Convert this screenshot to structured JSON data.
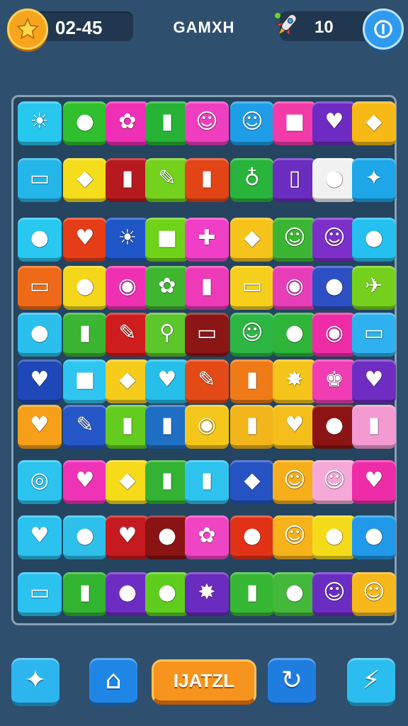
{
  "hud": {
    "timer": "02-45",
    "title": "GAMXH",
    "score": "10"
  },
  "bottom_bar": {
    "main_label": "IJATZL"
  },
  "board": {
    "rows": [
      [
        {
          "color": "#28c7ee",
          "glyph": "☀",
          "icon": "sun-icon"
        },
        {
          "color": "#2fbf2f",
          "glyph": "●",
          "icon": "fruit-icon"
        },
        {
          "color": "#ef2fb6",
          "glyph": "✿",
          "icon": "flame-icon"
        },
        {
          "color": "#27b336",
          "glyph": "▮",
          "icon": "phone-icon"
        },
        {
          "color": "#ef3ec0",
          "glyph": "☺",
          "icon": "face-icon"
        },
        {
          "color": "#1f9ee8",
          "glyph": "☺",
          "icon": "monster-icon"
        },
        {
          "color": "#f23aa8",
          "glyph": "■",
          "icon": "box-icon"
        },
        {
          "color": "#6d2bc4",
          "glyph": "♥",
          "icon": "heart-icon"
        },
        {
          "color": "#f6b916",
          "glyph": "◆",
          "icon": "candy-icon"
        }
      ],
      [
        {
          "color": "#24b6e8",
          "glyph": "▭",
          "icon": "eyes-icon"
        },
        {
          "color": "#f4dd1a",
          "glyph": "◆",
          "icon": "gem-icon"
        },
        {
          "color": "#b61a1f",
          "glyph": "▮",
          "icon": "battery-icon"
        },
        {
          "color": "#74d11c",
          "glyph": "✎",
          "icon": "pen-icon"
        },
        {
          "color": "#e24416",
          "glyph": "▮",
          "icon": "phone-icon"
        },
        {
          "color": "#29b43c",
          "glyph": "♁",
          "icon": "pin-icon"
        },
        {
          "color": "#6b2cc0",
          "glyph": "▯",
          "icon": "jar-icon"
        },
        {
          "color": "#f1f1f1",
          "glyph": "●",
          "icon": "orb-icon"
        },
        {
          "color": "#1da6e8",
          "glyph": "✦",
          "icon": "sparkle-icon"
        }
      ],
      [
        {
          "color": "#29c8f0",
          "glyph": "●",
          "icon": "bubble-icon"
        },
        {
          "color": "#e53d18",
          "glyph": "♥",
          "icon": "heart-icon"
        },
        {
          "color": "#1f55c6",
          "glyph": "☀",
          "icon": "sun-face-icon"
        },
        {
          "color": "#6fd31a",
          "glyph": "■",
          "icon": "bag-icon"
        },
        {
          "color": "#f03fc6",
          "glyph": "✚",
          "icon": "puzzle-icon"
        },
        {
          "color": "#f6c31b",
          "glyph": "◆",
          "icon": "balloon-icon"
        },
        {
          "color": "#3db534",
          "glyph": "☺",
          "icon": "apple-face-icon"
        },
        {
          "color": "#7c2fc9",
          "glyph": "☺",
          "icon": "alien-icon"
        },
        {
          "color": "#25bff0",
          "glyph": "●",
          "icon": "lollipop-icon"
        }
      ],
      [
        {
          "color": "#ef6a16",
          "glyph": "▭",
          "icon": "tv-icon"
        },
        {
          "color": "#f4d61a",
          "glyph": "●",
          "icon": "ball-icon"
        },
        {
          "color": "#ef30b2",
          "glyph": "◉",
          "icon": "speech-icon"
        },
        {
          "color": "#3fb530",
          "glyph": "✿",
          "icon": "bird-icon"
        },
        {
          "color": "#ec3ab8",
          "glyph": "▮",
          "icon": "bottle-icon"
        },
        {
          "color": "#f6cf1c",
          "glyph": "▭",
          "icon": "chest-icon"
        },
        {
          "color": "#e63db8",
          "glyph": "◉",
          "icon": "pin-icon"
        },
        {
          "color": "#2c4fc4",
          "glyph": "●",
          "icon": "plum-icon"
        },
        {
          "color": "#74d01c",
          "glyph": "✈",
          "icon": "rocket-icon"
        }
      ],
      [
        {
          "color": "#2bbfee",
          "glyph": "●",
          "icon": "grape-icon"
        },
        {
          "color": "#3bb532",
          "glyph": "▮",
          "icon": "eraser-icon"
        },
        {
          "color": "#cf1c1c",
          "glyph": "✎",
          "icon": "pencil-icon"
        },
        {
          "color": "#5dc62b",
          "glyph": "⚲",
          "icon": "racket-icon"
        },
        {
          "color": "#8c1515",
          "glyph": "▭",
          "icon": "card-icon"
        },
        {
          "color": "#2db644",
          "glyph": "☺",
          "icon": "ball-face-icon"
        },
        {
          "color": "#2fb43a",
          "glyph": "●",
          "icon": "balloon-icon"
        },
        {
          "color": "#ef2ca6",
          "glyph": "◉",
          "icon": "donut-icon"
        },
        {
          "color": "#2fb1ef",
          "glyph": "▭",
          "icon": "tablet-icon"
        }
      ],
      [
        {
          "color": "#1e47b8",
          "glyph": "♥",
          "icon": "heart-icon"
        },
        {
          "color": "#2ec6f0",
          "glyph": "■",
          "icon": "cube-icon"
        },
        {
          "color": "#f6cc1c",
          "glyph": "◆",
          "icon": "drop-icon"
        },
        {
          "color": "#25bfea",
          "glyph": "♥",
          "icon": "heart-icon"
        },
        {
          "color": "#e34a16",
          "glyph": "✎",
          "icon": "crayon-icon"
        },
        {
          "color": "#f07a17",
          "glyph": "▮",
          "icon": "battery-icon"
        },
        {
          "color": "#f5c41b",
          "glyph": "✸",
          "icon": "star-burst-icon"
        },
        {
          "color": "#f03db4",
          "glyph": "♚",
          "icon": "crown-icon"
        },
        {
          "color": "#6f2cc2",
          "glyph": "♥",
          "icon": "heart-icon"
        }
      ],
      [
        {
          "color": "#f6a01a",
          "glyph": "♥",
          "icon": "apple-icon"
        },
        {
          "color": "#2657c9",
          "glyph": "✎",
          "icon": "pencil-icon"
        },
        {
          "color": "#63cc1f",
          "glyph": "▮",
          "icon": "cup-icon"
        },
        {
          "color": "#1f6fc4",
          "glyph": "▮",
          "icon": "phone-icon"
        },
        {
          "color": "#f4c61a",
          "glyph": "◉",
          "icon": "ring-icon"
        },
        {
          "color": "#f2b61b",
          "glyph": "▮",
          "icon": "phone-icon"
        },
        {
          "color": "#f4be1b",
          "glyph": "♥",
          "icon": "heart-icon"
        },
        {
          "color": "#8d1414",
          "glyph": "●",
          "icon": "leaf-icon"
        },
        {
          "color": "#f39ad2",
          "glyph": "▮",
          "icon": "battery-icon"
        }
      ],
      [
        {
          "color": "#2cc4ef",
          "glyph": "◎",
          "icon": "target-icon"
        },
        {
          "color": "#ef33b6",
          "glyph": "♥",
          "icon": "heart-icon"
        },
        {
          "color": "#f6db1a",
          "glyph": "◆",
          "icon": "gem-icon"
        },
        {
          "color": "#34b233",
          "glyph": "▮",
          "icon": "battery-icon"
        },
        {
          "color": "#2ec2ee",
          "glyph": "▮",
          "icon": "phone-icon"
        },
        {
          "color": "#2653c4",
          "glyph": "◆",
          "icon": "gem-icon"
        },
        {
          "color": "#f6ae1a",
          "glyph": "☺",
          "icon": "smiley-icon"
        },
        {
          "color": "#f4a9d8",
          "glyph": "☺",
          "icon": "cat-face-icon"
        },
        {
          "color": "#ef2ca7",
          "glyph": "♥",
          "icon": "heart-icon"
        }
      ],
      [
        {
          "color": "#2bc2ef",
          "glyph": "♥",
          "icon": "heart-icon"
        },
        {
          "color": "#2ec0ea",
          "glyph": "●",
          "icon": "balloon-icon"
        },
        {
          "color": "#c51a1f",
          "glyph": "♥",
          "icon": "heart-icon"
        },
        {
          "color": "#8a1313",
          "glyph": "●",
          "icon": "ring-icon"
        },
        {
          "color": "#ef45c4",
          "glyph": "✿",
          "icon": "flower-icon"
        },
        {
          "color": "#e13218",
          "glyph": "●",
          "icon": "lollipop-icon"
        },
        {
          "color": "#f6b21a",
          "glyph": "☺",
          "icon": "apple-face-icon"
        },
        {
          "color": "#f4db1a",
          "glyph": "●",
          "icon": "orb-icon"
        },
        {
          "color": "#1f99e8",
          "glyph": "●",
          "icon": "lime-icon"
        }
      ],
      [
        {
          "color": "#2bc2ef",
          "glyph": "▭",
          "icon": "card-icon"
        },
        {
          "color": "#33b431",
          "glyph": "▮",
          "icon": "eraser-icon"
        },
        {
          "color": "#6d2dc3",
          "glyph": "●",
          "icon": "balloon-icon"
        },
        {
          "color": "#5fcd1e",
          "glyph": "●",
          "icon": "lollipop-icon"
        },
        {
          "color": "#6a2bbf",
          "glyph": "✸",
          "icon": "sun-burst-icon"
        },
        {
          "color": "#37b834",
          "glyph": "▮",
          "icon": "jar-icon"
        },
        {
          "color": "#43b83a",
          "glyph": "●",
          "icon": "leaf-icon"
        },
        {
          "color": "#6a2dc4",
          "glyph": "☺",
          "icon": "bird-face-icon"
        },
        {
          "color": "#f6b81a",
          "glyph": "☺",
          "icon": "fish-face-icon"
        }
      ]
    ]
  },
  "bottom_buttons": [
    {
      "name": "rabbit-button",
      "icon": "rabbit-icon",
      "glyph": "✦",
      "color": "#2db5ef"
    },
    {
      "name": "home-button",
      "icon": "home-icon",
      "glyph": "⌂",
      "color": "#2086e6"
    },
    {
      "name": "restart-button",
      "icon": "restart-icon",
      "glyph": "↻",
      "color": "#1f7de0"
    },
    {
      "name": "boost-button",
      "icon": "lightning-icon",
      "glyph": "⚡",
      "color": "#2cbdf0"
    }
  ]
}
